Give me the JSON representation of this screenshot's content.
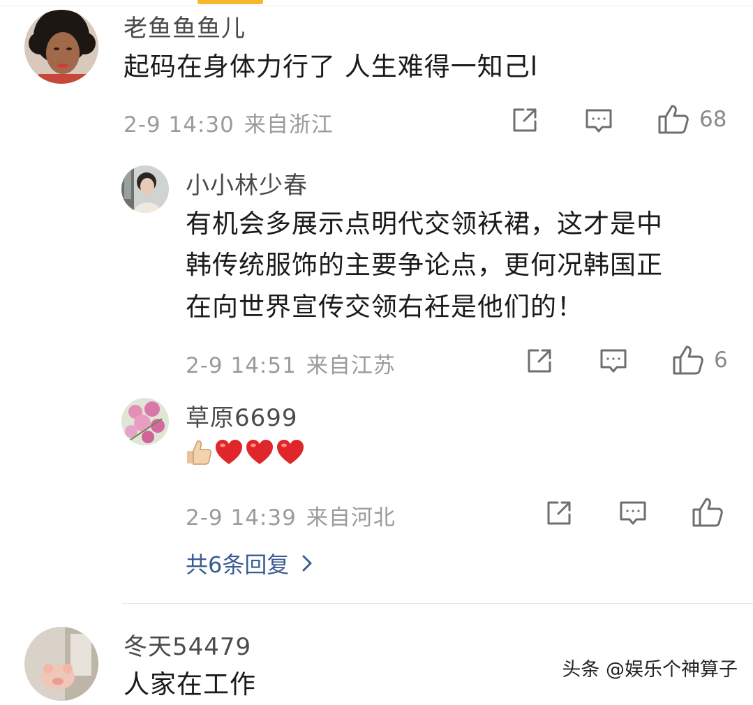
{
  "comments": [
    {
      "username": "老鱼鱼鱼儿",
      "text": "起码在身体力行了 人生难得一知己l",
      "date": "2-9 14:30",
      "location": "来自浙江",
      "likes": "68"
    },
    {
      "username": "小小林少春",
      "lines": [
        "有机会多展示点明代交领袄裙，这才是中",
        "韩传统服饰的主要争论点，更何况韩国正",
        "在向世界宣传交领右衽是他们的！"
      ],
      "date": "2-9 14:51",
      "location": "来自江苏",
      "likes": "6"
    },
    {
      "username": "草原6699",
      "emoji": [
        "thumbs-up",
        "heart",
        "heart",
        "heart"
      ],
      "date": "2-9 14:39",
      "location": "来自河北",
      "likes": ""
    },
    {
      "username": "冬天54479",
      "text": "人家在工作"
    }
  ],
  "replies_link": "共6条回复",
  "watermark": "头条 @娱乐个神算子",
  "colors": {
    "link": "#3b5c91",
    "meta": "#9b9b9b",
    "accent_tab": "#f5b82c"
  }
}
